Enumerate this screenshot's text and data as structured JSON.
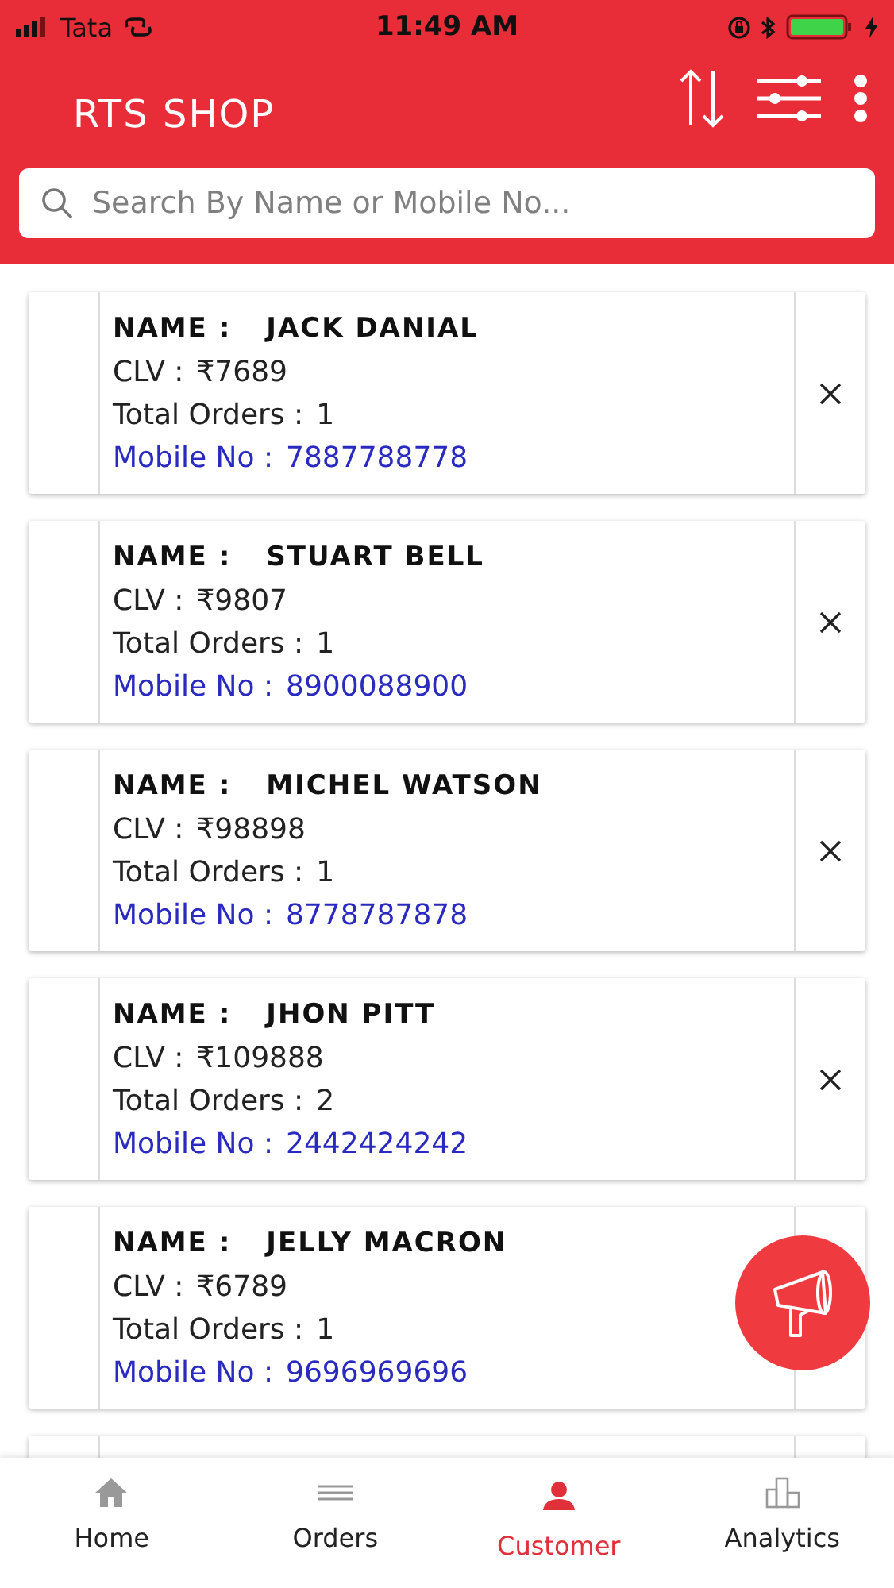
{
  "status_bar": {
    "carrier": "Tata",
    "time": "11:49 AM"
  },
  "app_bar": {
    "title": "RTS SHOP"
  },
  "search": {
    "placeholder": "Search By Name or Mobile No..."
  },
  "customers": [
    {
      "name_label": "NAME :",
      "name": "JACK DANIAL",
      "clv_label": "CLV :",
      "clv": "₹7689",
      "orders_label": "Total Orders :",
      "orders": "1",
      "mobile_label": "Mobile No :",
      "mobile": "7887788778",
      "close": true
    },
    {
      "name_label": "NAME :",
      "name": "STUART BELL",
      "clv_label": "CLV :",
      "clv": "₹9807",
      "orders_label": "Total Orders :",
      "orders": "1",
      "mobile_label": "Mobile No :",
      "mobile": "8900088900",
      "close": true
    },
    {
      "name_label": "NAME :",
      "name": "MICHEL WATSON",
      "clv_label": "CLV :",
      "clv": "₹98898",
      "orders_label": "Total Orders :",
      "orders": "1",
      "mobile_label": "Mobile No :",
      "mobile": "8778787878",
      "close": true
    },
    {
      "name_label": "NAME :",
      "name": "JHON PITT",
      "clv_label": "CLV :",
      "clv": "₹109888",
      "orders_label": "Total Orders :",
      "orders": "2",
      "mobile_label": "Mobile No :",
      "mobile": "2442424242",
      "close": true
    },
    {
      "name_label": "NAME :",
      "name": "JELLY MACRON",
      "clv_label": "CLV :",
      "clv": "₹6789",
      "orders_label": "Total Orders :",
      "orders": "1",
      "mobile_label": "Mobile No :",
      "mobile": "9696969696",
      "close": false
    }
  ],
  "bottom_nav": [
    {
      "label": "Home",
      "selected": false
    },
    {
      "label": "Orders",
      "selected": false
    },
    {
      "label": "Customer",
      "selected": true
    },
    {
      "label": "Analytics",
      "selected": false
    }
  ]
}
